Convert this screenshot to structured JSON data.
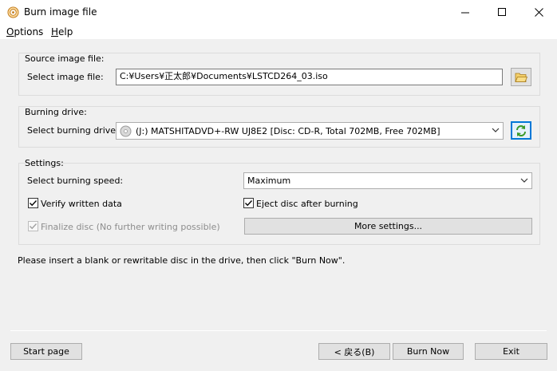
{
  "window": {
    "title": "Burn image file",
    "icon": "disc-icon"
  },
  "menu": {
    "options": "Options",
    "options_mnemonic": "O",
    "options_rest": "ptions",
    "help": "Help",
    "help_mnemonic": "H",
    "help_rest": "elp"
  },
  "source": {
    "group_title": "Source image file:",
    "label": "Select image file:",
    "path": "C:¥Users¥正太郎¥Documents¥LSTCD264_03.iso",
    "browse_icon": "folder-open-icon"
  },
  "drive": {
    "group_title": "Burning drive:",
    "label": "Select burning drive:",
    "selected": "(J:) MATSHITADVD+-RW UJ8E2 [Disc: CD-R, Total 702MB, Free 702MB]",
    "refresh_icon": "refresh-icon"
  },
  "settings": {
    "group_title": "Settings:",
    "speed_label": "Select burning speed:",
    "speed_value": "Maximum",
    "verify_label": "Verify written data",
    "verify_checked": true,
    "eject_label": "Eject disc after burning",
    "eject_checked": true,
    "finalize_label": "Finalize disc (No further writing possible)",
    "finalize_checked": true,
    "finalize_enabled": false,
    "more_settings": "More settings..."
  },
  "status_message": "Please insert a blank or rewritable disc in the drive, then click \"Burn Now\".",
  "footer": {
    "start_page": "Start page",
    "back": "< 戻る(B)",
    "burn_now": "Burn Now",
    "exit": "Exit"
  },
  "colors": {
    "accent": "#0078d7",
    "folder": "#e8b84a",
    "refresh": "#3a9a2a"
  }
}
